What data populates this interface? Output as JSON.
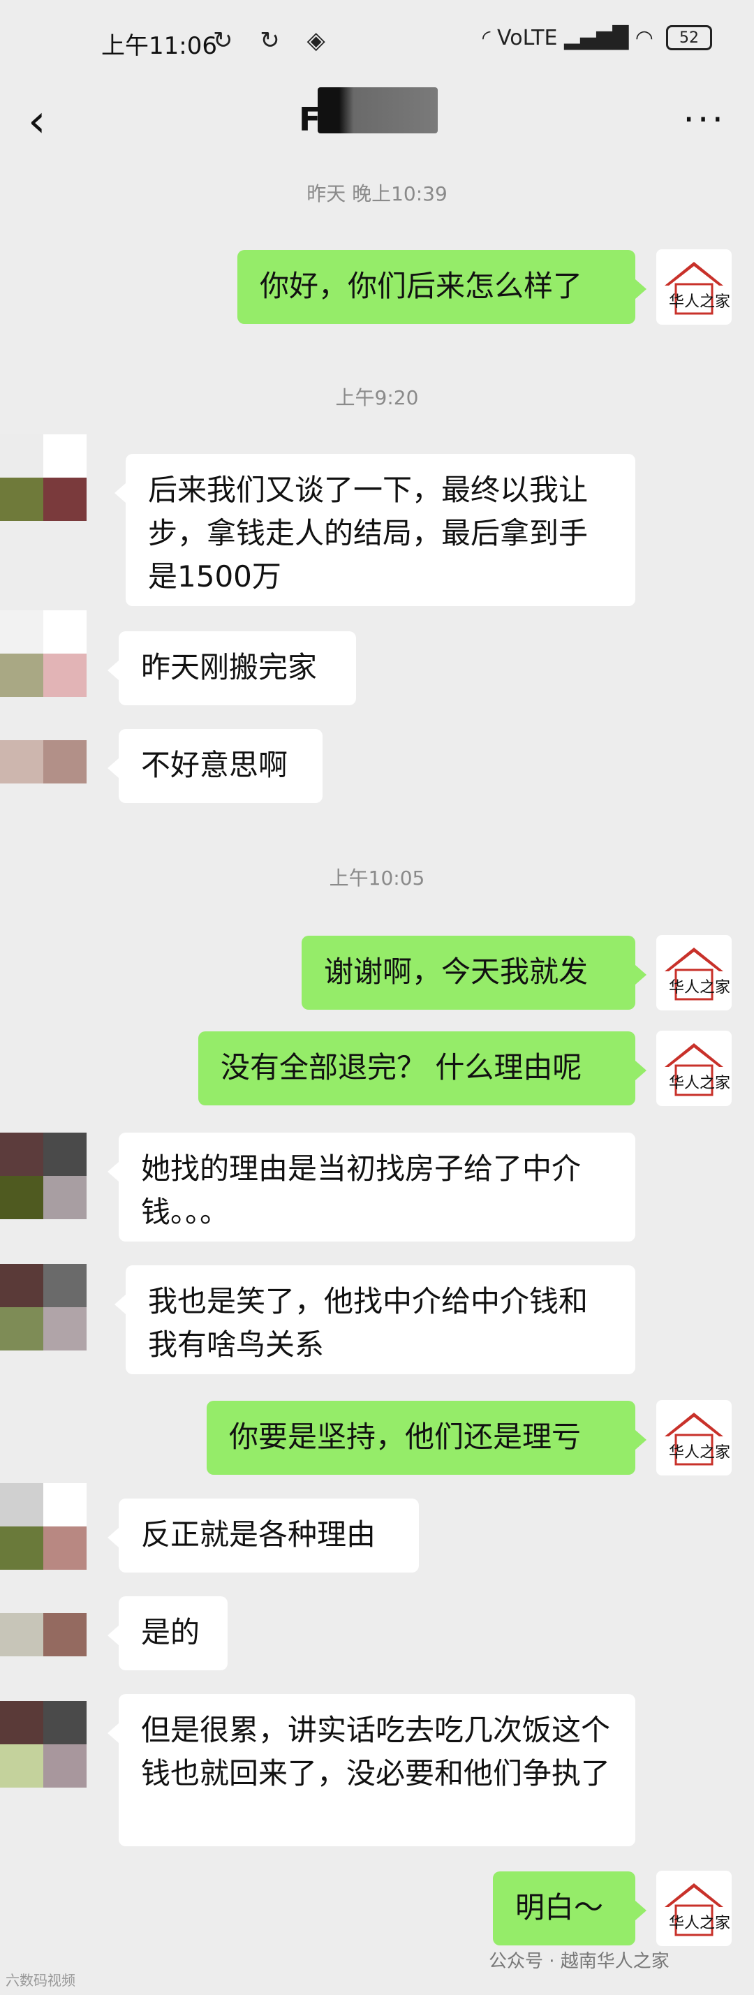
{
  "status_bar": {
    "time": "上午11:06",
    "left_icons": "↻ ↻ ◈",
    "right_icons": "◜  VoLTE  ▂▄▆█  ◠",
    "battery": "52"
  },
  "header": {
    "title": "F",
    "back_icon": "‹",
    "more_icon": "···"
  },
  "timestamps": [
    "昨天 晚上10:39",
    "上午9:20",
    "上午10:05"
  ],
  "messages": [
    {
      "dir": "out",
      "text": "你好，你们后来怎么样了"
    },
    {
      "dir": "in",
      "text": "后来我们又谈了一下，最终以我让步，拿钱走人的结局，最后拿到手是1500万"
    },
    {
      "dir": "in",
      "text": "昨天刚搬完家"
    },
    {
      "dir": "in",
      "text": "不好意思啊"
    },
    {
      "dir": "out",
      "text": "谢谢啊，今天我就发"
    },
    {
      "dir": "out",
      "text": "没有全部退完？ 什么理由呢"
    },
    {
      "dir": "in",
      "text": "她找的理由是当初找房子给了中介钱。。。"
    },
    {
      "dir": "in",
      "text": "我也是笑了，他找中介给中介钱和我有啥鸟关系"
    },
    {
      "dir": "out",
      "text": "你要是坚持，他们还是理亏"
    },
    {
      "dir": "in",
      "text": "反正就是各种理由"
    },
    {
      "dir": "in",
      "text": "是的"
    },
    {
      "dir": "in",
      "text": "但是很累，讲实话吃去吃几次饭这个钱也就回来了，没必要和他们争执了"
    },
    {
      "dir": "out",
      "text": "明白～"
    }
  ],
  "watermark": "公众号 · 越南华人之家",
  "footer_left": "六数码视频",
  "colors": {
    "out_bubble": "#95ec69",
    "in_bubble": "#ffffff",
    "background": "#ededed"
  }
}
